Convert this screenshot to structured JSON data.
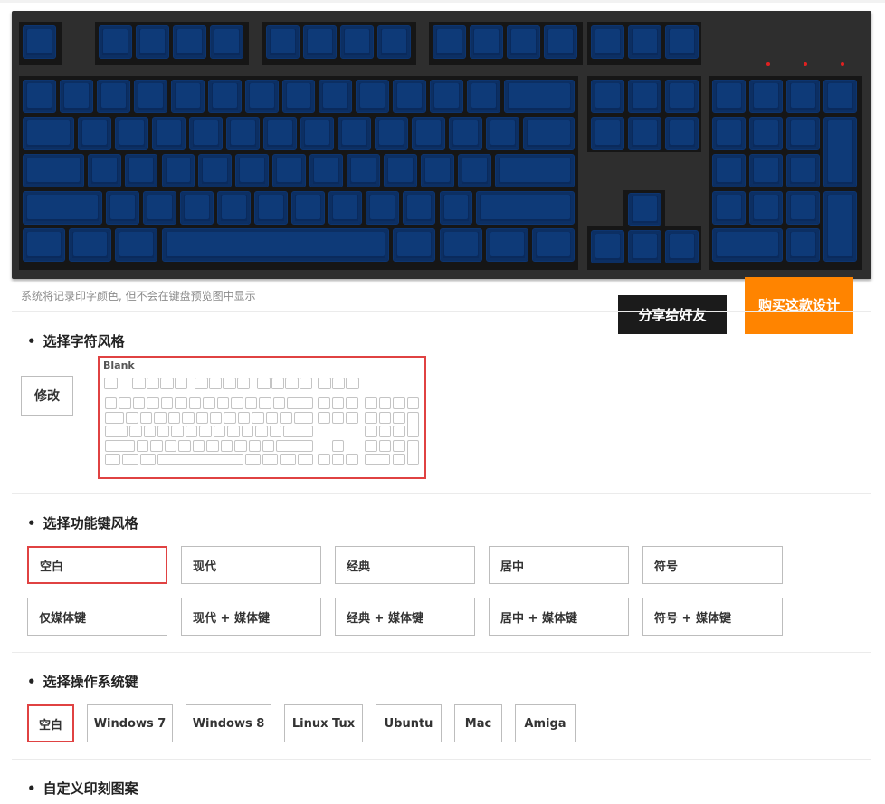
{
  "preview_note": "系统将记录印字颜色, 但不会在键盘预览图中显示",
  "actions": {
    "share_label": "分享给好友",
    "buy_label": "购买这款设计"
  },
  "sections": {
    "char_style": {
      "title": "选择字符风格",
      "modify_label": "修改",
      "current_style": "Blank"
    },
    "function_key_style": {
      "title": "选择功能键风格",
      "options": [
        "空白",
        "现代",
        "经典",
        "居中",
        "符号",
        "仅媒体键",
        "现代 + 媒体键",
        "经典 + 媒体键",
        "居中 + 媒体键",
        "符号 + 媒体键"
      ],
      "selected": "空白"
    },
    "os_key": {
      "title": "选择操作系统键",
      "options": [
        "空白",
        "Windows 7",
        "Windows 8",
        "Linux Tux",
        "Ubuntu",
        "Mac",
        "Amiga"
      ],
      "selected": "空白"
    },
    "custom_print": {
      "title": "自定义印刻图案"
    }
  },
  "colors": {
    "keycap": "#0a2a5c",
    "case": "#2e2e2e",
    "selected_border": "#e04242",
    "buy_button": "#ff8400",
    "share_button": "#1b1b1b",
    "led": "#e02020"
  }
}
